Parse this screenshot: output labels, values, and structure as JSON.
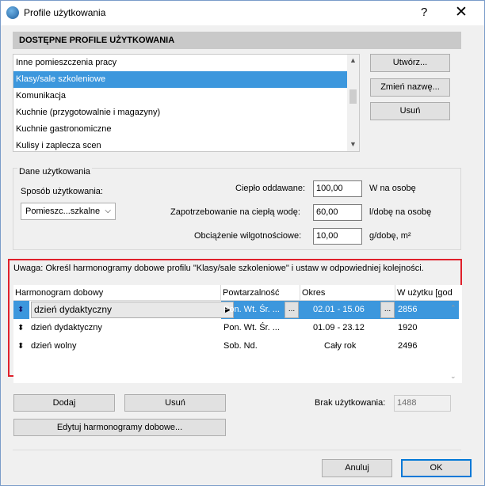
{
  "window": {
    "title": "Profile użytkowania",
    "help": "?",
    "close": "✕"
  },
  "profiles": {
    "header": "DOSTĘPNE PROFILE UŻYTKOWANIA",
    "items": [
      "Inne pomieszczenia pracy",
      "Klasy/sale szkoleniowe",
      "Komunikacja",
      "Kuchnie (przygotowalnie i magazyny)",
      "Kuchnie gastronomiczne",
      "Kulisy i zaplecza scen"
    ],
    "selected": "Klasy/sale szkoleniowe",
    "buttons": {
      "create": "Utwórz...",
      "rename": "Zmień nazwę...",
      "delete": "Usuń"
    }
  },
  "usage_data": {
    "group_title": "Dane użytkowania",
    "mode_label": "Sposób użytkowania:",
    "mode_value": "Pomieszc...szkalne",
    "heat_label": "Ciepło oddawane:",
    "heat_value": "100,00",
    "heat_unit": "W na osobę",
    "water_label": "Zapotrzebowanie na ciepłą wodę:",
    "water_value": "60,00",
    "water_unit": "l/dobę na osobę",
    "humidity_label": "Obciążenie wilgotnościowe:",
    "humidity_value": "10,00",
    "humidity_unit": "g/dobę, m²"
  },
  "schedules": {
    "note": "Uwaga: Określ harmonogramy dobowe profilu \"Klasy/sale szkoleniowe\" i ustaw w odpowiedniej kolejności.",
    "columns": [
      "Harmonogram dobowy",
      "Powtarzalność",
      "Okres",
      "W użytku [god"
    ],
    "rows": [
      {
        "name": "dzień dydaktyczny",
        "repeat": "Pon. Wt. Śr. ...",
        "period": "02.01 - 15.06",
        "hours": "2856"
      },
      {
        "name": "dzień dydaktyczny",
        "repeat": "Pon. Wt. Śr. ...",
        "period": "01.09 - 23.12",
        "hours": "1920"
      },
      {
        "name": "dzień wolny",
        "repeat": "Sob. Nd.",
        "period": "Cały rok",
        "hours": "2496"
      }
    ],
    "ellipsis": "...",
    "buttons": {
      "add": "Dodaj",
      "delete": "Usuń",
      "edit": "Edytuj harmonogramy dobowe..."
    },
    "no_use_label": "Brak użytkowania:",
    "no_use_value": "1488"
  },
  "footer": {
    "cancel": "Anuluj",
    "ok": "OK"
  },
  "colors": {
    "selection": "#3c97dd",
    "highlight_border": "#e0202a",
    "header_bg": "#c9c9c9"
  }
}
